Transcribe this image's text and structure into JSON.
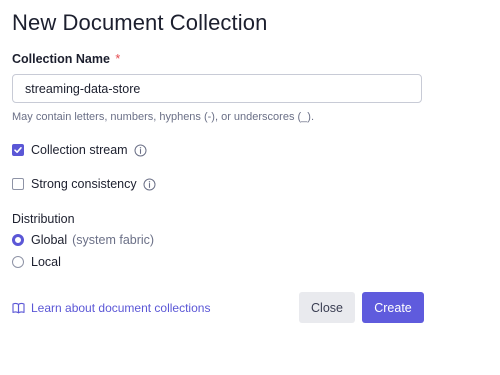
{
  "dialog": {
    "title": "New Document Collection"
  },
  "collection_name": {
    "label": "Collection Name",
    "required_marker": "*",
    "value": "streaming-data-store",
    "hint": "May contain letters, numbers, hyphens (-), or underscores (_)."
  },
  "options": {
    "collection_stream": {
      "label": "Collection stream",
      "checked": true
    },
    "strong_consistency": {
      "label": "Strong consistency",
      "checked": false
    }
  },
  "distribution": {
    "label": "Distribution",
    "options": [
      {
        "label": "Global",
        "note": "(system fabric)",
        "selected": true
      },
      {
        "label": "Local",
        "note": "",
        "selected": false
      }
    ]
  },
  "footer": {
    "learn_link": "Learn about document collections",
    "close_label": "Close",
    "create_label": "Create"
  },
  "colors": {
    "accent": "#5b57d6",
    "required": "#e5484d",
    "muted_text": "#6b7087"
  },
  "icons": {
    "info": "info-icon",
    "check": "checkmark-icon",
    "book": "book-icon"
  }
}
